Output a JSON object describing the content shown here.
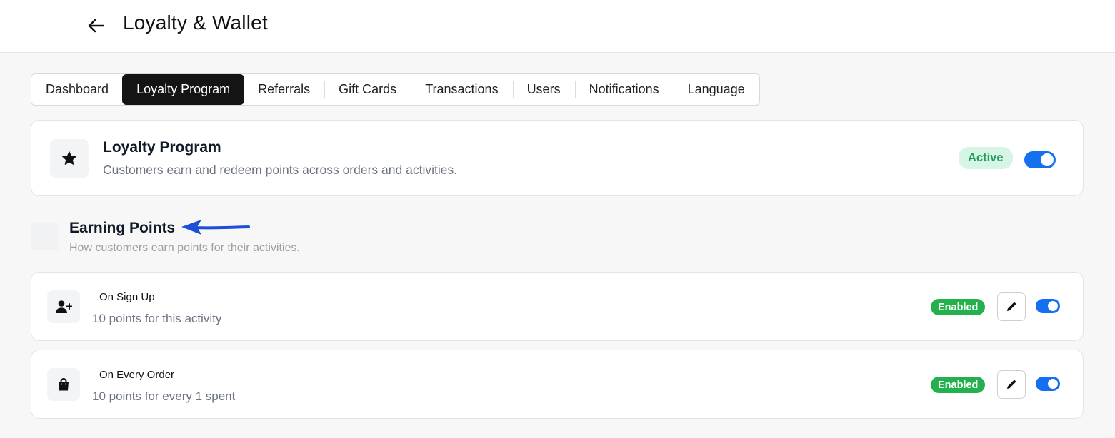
{
  "header": {
    "title": "Loyalty & Wallet",
    "back_icon": "arrow-left-icon"
  },
  "tabs": [
    {
      "label": "Dashboard",
      "active": false
    },
    {
      "label": "Loyalty Program",
      "active": true
    },
    {
      "label": "Referrals",
      "active": false
    },
    {
      "label": "Gift Cards",
      "active": false
    },
    {
      "label": "Transactions",
      "active": false
    },
    {
      "label": "Users",
      "active": false
    },
    {
      "label": "Notifications",
      "active": false
    },
    {
      "label": "Language",
      "active": false
    }
  ],
  "program": {
    "icon": "star-icon",
    "title": "Loyalty Program",
    "description": "Customers earn and redeem points across orders and activities.",
    "status": "Active",
    "enabled": true
  },
  "earning": {
    "title": "Earning Points",
    "description": "How customers earn points for their activities.",
    "activities": [
      {
        "icon": "user-plus-icon",
        "title": "On Sign Up",
        "description": "10 points for this activity",
        "status": "Enabled",
        "enabled": true
      },
      {
        "icon": "shopping-bag-icon",
        "title": "On Every Order",
        "description": "10 points for every 1 spent",
        "status": "Enabled",
        "enabled": true
      }
    ]
  },
  "colors": {
    "accent": "#1570ef",
    "active_badge_bg": "#d6f5e4",
    "active_badge_text": "#1f9d5b",
    "enabled_badge": "#22b14c",
    "annotation_arrow": "#1d4ed8"
  }
}
